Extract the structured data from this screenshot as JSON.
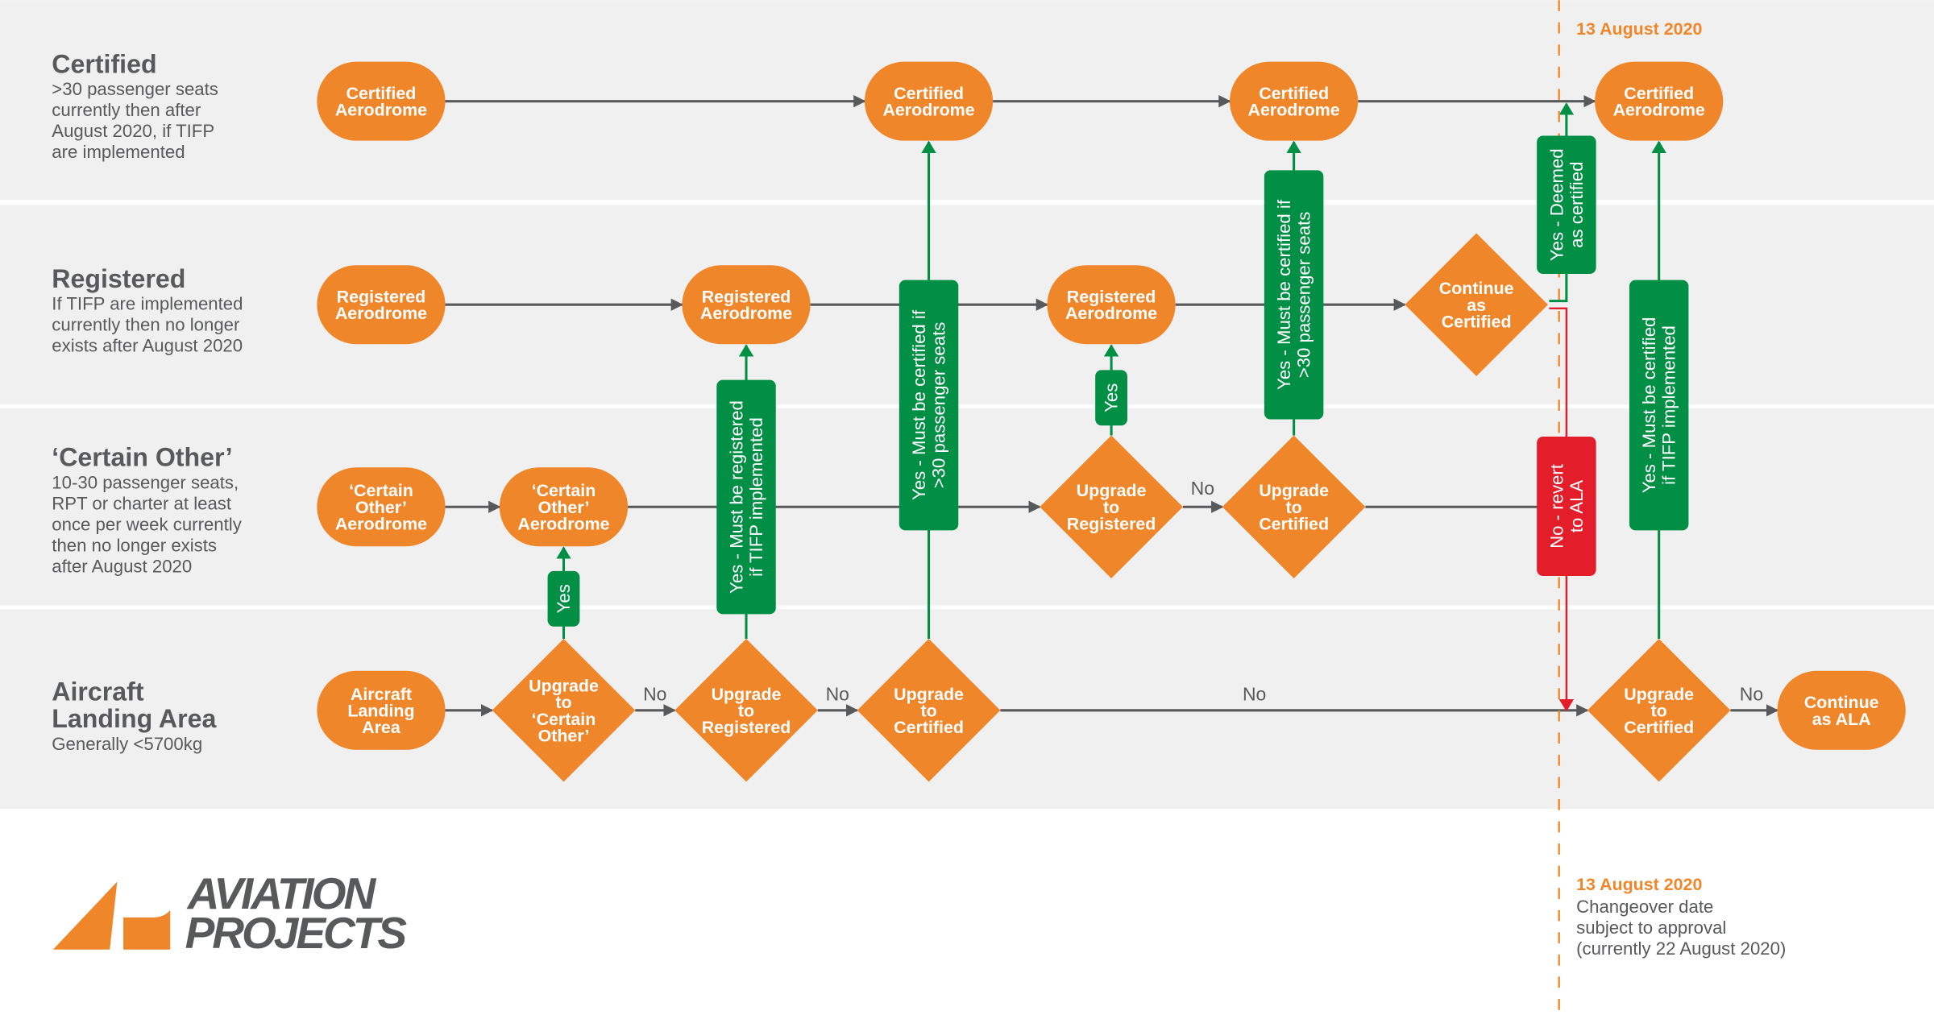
{
  "colors": {
    "orange": "#f0862a",
    "green": "#008f44",
    "red": "#e31e2a",
    "line_gray": "#58595b",
    "lane_bg": "#f0f0f0"
  },
  "lanes": [
    {
      "title": "Certified",
      "desc": [
        ">30 passenger seats",
        "currently then after",
        "August 2020, if TIFP",
        "are implemented"
      ]
    },
    {
      "title": "Registered",
      "desc": [
        "If TIFP are implemented",
        "currently then no longer",
        "exists after August 2020"
      ]
    },
    {
      "title": "‘Certain Other’",
      "desc": [
        "10-30 passenger seats,",
        "RPT or charter at least",
        "once per week currently",
        "then no longer exists",
        "after August 2020"
      ]
    },
    {
      "title": [
        "Aircraft",
        "Landing Area"
      ],
      "desc": [
        "Generally <5700kg"
      ]
    }
  ],
  "nodes": {
    "cert_1": [
      "Certified",
      "Aerodrome"
    ],
    "cert_2": [
      "Certified",
      "Aerodrome"
    ],
    "cert_3": [
      "Certified",
      "Aerodrome"
    ],
    "cert_4": [
      "Certified",
      "Aerodrome"
    ],
    "reg_1": [
      "Registered",
      "Aerodrome"
    ],
    "reg_2": [
      "Registered",
      "Aerodrome"
    ],
    "reg_3": [
      "Registered",
      "Aerodrome"
    ],
    "co_1": [
      "‘Certain",
      "Other’",
      "Aerodrome"
    ],
    "co_2": [
      "‘Certain",
      "Other’",
      "Aerodrome"
    ],
    "ala_1": [
      "Aircraft",
      "Landing",
      "Area"
    ],
    "continue_ala": [
      "Continue",
      "as ALA"
    ]
  },
  "decisions": {
    "up_co": [
      "Upgrade",
      "to",
      "‘Certain",
      "Other’"
    ],
    "up_reg_ala": [
      "Upgrade",
      "to",
      "Registered"
    ],
    "up_cert_ala": [
      "Upgrade",
      "to",
      "Certified"
    ],
    "up_reg_co": [
      "Upgrade",
      "to",
      "Registered"
    ],
    "up_cert_co": [
      "Upgrade",
      "to",
      "Certified"
    ],
    "continue_cert": [
      "Continue",
      "as",
      "Certified"
    ],
    "up_cert_final": [
      "Upgrade",
      "to",
      "Certified"
    ]
  },
  "condition_boxes": {
    "yes_co": [
      "Yes"
    ],
    "must_reg": [
      "Yes - Must be registered",
      "if TIFP implemented"
    ],
    "must_cert_1": [
      "Yes - Must be certified if",
      ">30 passenger seats"
    ],
    "yes_reg": [
      "Yes"
    ],
    "must_cert_2": [
      "Yes - Must be certified if",
      ">30 passenger seats"
    ],
    "deemed": [
      "Yes - Deemed",
      "as certified"
    ],
    "revert": [
      "No - revert",
      "to ALA"
    ],
    "must_cert_tifp": [
      "Yes - Must be certified",
      "if TIFP implemented"
    ]
  },
  "edge_labels": {
    "no_1": "No",
    "no_2": "No",
    "no_3": "No",
    "no_co": "No",
    "no_final": "No"
  },
  "changeover": {
    "top_date": "13 August 2020",
    "note_date": "13 August 2020",
    "note_lines": [
      "Changeover date",
      "subject to approval",
      "(currently 22 August 2020)"
    ]
  },
  "logo": {
    "line1": "AVIATION",
    "line2": "PROJECTS"
  }
}
